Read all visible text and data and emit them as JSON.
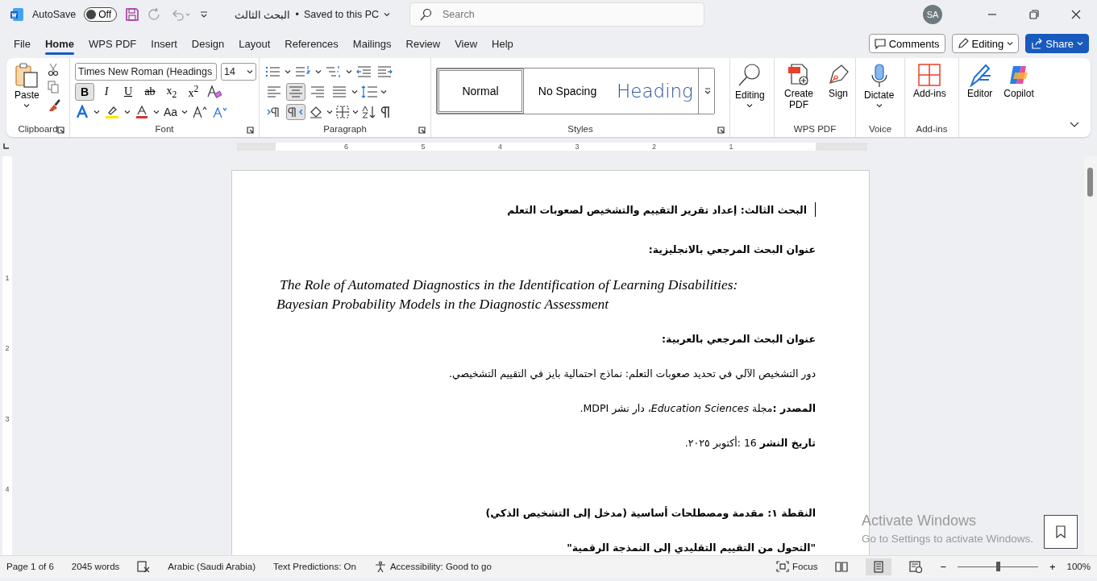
{
  "titlebar": {
    "autosave_label": "AutoSave",
    "autosave": {
      "label": "Off",
      "on": false
    },
    "document_title": "البحث الثالث",
    "separator": "•",
    "save_state": "Saved to this PC",
    "search": {
      "placeholder": "Search"
    },
    "avatar": "SA"
  },
  "menu_tabs": [
    {
      "label": "File",
      "selected": false
    },
    {
      "label": "Home",
      "selected": true
    },
    {
      "label": "WPS PDF",
      "selected": false
    },
    {
      "label": "Insert",
      "selected": false
    },
    {
      "label": "Design",
      "selected": false
    },
    {
      "label": "Layout",
      "selected": false
    },
    {
      "label": "References",
      "selected": false
    },
    {
      "label": "Mailings",
      "selected": false
    },
    {
      "label": "Review",
      "selected": false
    },
    {
      "label": "View",
      "selected": false
    },
    {
      "label": "Help",
      "selected": false
    }
  ],
  "menu_buttons": {
    "comments": "Comments",
    "editing": "Editing",
    "share": "Share"
  },
  "ribbon": {
    "clipboard": {
      "label": "Clipboard",
      "paste": "Paste"
    },
    "font": {
      "label": "Font",
      "family": "Times New Roman (Headings",
      "size": "14",
      "format_buttons": [
        {
          "kind": "bold",
          "label": "B",
          "on": true
        },
        {
          "kind": "italic",
          "label": "I",
          "on": false
        },
        {
          "kind": "underline",
          "label": "U",
          "on": false
        },
        {
          "kind": "strike",
          "label": "ab",
          "on": false
        },
        {
          "kind": "subscript",
          "label": "x$_{2}$",
          "on": false
        },
        {
          "kind": "superscript",
          "label": "x$^{2}$",
          "on": false
        }
      ],
      "case_label": "Aa"
    },
    "paragraph": {
      "label": "Paragraph",
      "alignments": [
        {
          "kind": "left",
          "selected": false
        },
        {
          "kind": "center",
          "selected": true
        },
        {
          "kind": "right",
          "selected": false
        },
        {
          "kind": "justify",
          "selected": false
        }
      ],
      "directions": [
        {
          "kind": "ltr",
          "selected": false
        },
        {
          "kind": "rtl",
          "selected": true
        }
      ]
    },
    "styles": {
      "label": "Styles",
      "items": [
        {
          "label": "Normal",
          "kind": "body",
          "selected": true
        },
        {
          "label": "No Spacing",
          "kind": "body",
          "selected": false
        },
        {
          "label": "Heading",
          "kind": "heading",
          "selected": false
        }
      ]
    },
    "editing": "Editing",
    "wps": {
      "label": "WPS PDF",
      "create": "Create PDF",
      "sign": "Sign"
    },
    "voice": {
      "label": "Voice",
      "dictate": "Dictate"
    },
    "addins": {
      "label": "Add-ins",
      "button": "Add-ins"
    },
    "editor": "Editor",
    "copilot": "Copilot"
  },
  "ruler_numbers": [
    "6",
    "5",
    "4",
    "3",
    "2",
    "1"
  ],
  "vertical_ruler_numbers": [
    "1",
    "2",
    "3",
    "4"
  ],
  "document": [
    {
      "kind": "title",
      "text": "البحث الثالث: إعداد تقرير التقييم والتشخيص لصعوبات التعلم",
      "cursor": true
    },
    {
      "kind": "label",
      "text": "عنوان البحث المرجعي بالانجليزية:"
    },
    {
      "kind": "english",
      "text": "The Role of Automated Diagnostics in the Identification of Learning Disabilities: Bayesian Probability Models in the Diagnostic Assessment"
    },
    {
      "kind": "label",
      "text": "عنوان البحث المرجعي بالعربية:"
    },
    {
      "kind": "body",
      "text": "دور التشخيص الآلي في تحديد صعوبات التعلم: نماذج احتمالية بايز في التقييم التشخيصي."
    },
    {
      "kind": "body",
      "text": "**المصدر :**مجلة *Education Sciences*، دار نشر MDPI."
    },
    {
      "kind": "body",
      "text": "**تاريخ النشر** 16 :أكتوبر ٢٠٢٥."
    },
    {
      "kind": "section",
      "text": "النقطة ١: مقدمة ومصطلحات أساسية (مدخل إلى التشخيص الذكي)"
    },
    {
      "kind": "label",
      "text": "\"التحول من التقييم التقليدي إلى النمذجة الرقمية\""
    }
  ],
  "activation": {
    "title": "Activate Windows",
    "hint": "Go to Settings to activate Windows."
  },
  "status_bar": {
    "page": "Page 1 of 6",
    "words": "2045 words",
    "language": "Arabic (Saudi Arabia)",
    "predictions": "Text Predictions: On",
    "accessibility": "Accessibility: Good to go",
    "focus": "Focus",
    "views": [
      {
        "kind": "read",
        "selected": false
      },
      {
        "kind": "print",
        "selected": true
      },
      {
        "kind": "web",
        "selected": false
      }
    ],
    "zoom_out": "−",
    "zoom_in": "+",
    "zoom": {
      "level": 0.5
    },
    "zoom_label": "100%"
  }
}
